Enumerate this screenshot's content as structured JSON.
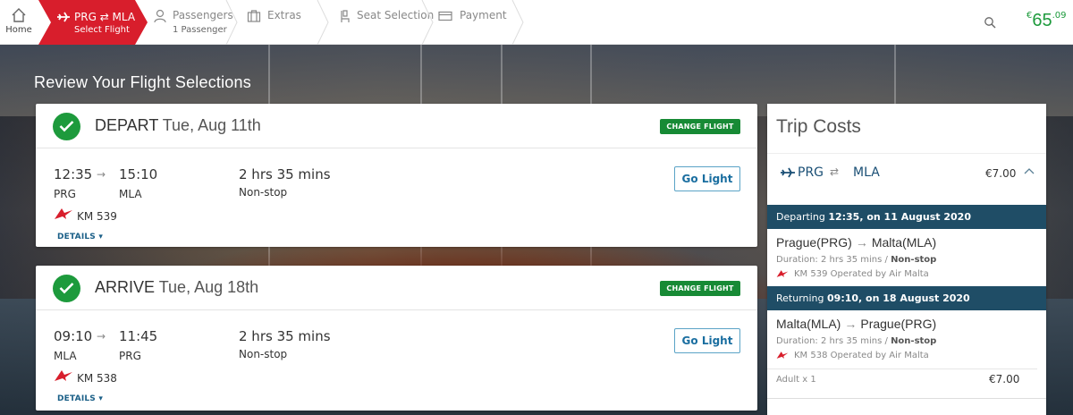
{
  "nav": {
    "home_label": "Home",
    "active": {
      "route": "PRG ⇄ MLA",
      "sub": "Select Flight"
    },
    "steps": [
      {
        "label": "Passengers",
        "sub": "1 Passenger"
      },
      {
        "label": "Extras"
      },
      {
        "label": "Seat Selection"
      },
      {
        "label": "Payment"
      }
    ],
    "total": {
      "currency": "€",
      "main": "65",
      "cents": ".09"
    }
  },
  "review_title": "Review Your Flight Selections",
  "flights": [
    {
      "direction": "DEPART",
      "date": "Tue, Aug 11th",
      "change_label": "CHANGE FLIGHT",
      "dep_time": "12:35",
      "arr_time": "15:10",
      "from": "PRG",
      "to": "MLA",
      "duration": "2 hrs 35 mins",
      "stops": "Non-stop",
      "flight_no": "KM 539",
      "details_label": "DETAILS ▾",
      "fare_button": "Go Light"
    },
    {
      "direction": "ARRIVE",
      "date": "Tue, Aug 18th",
      "change_label": "CHANGE FLIGHT",
      "dep_time": "09:10",
      "arr_time": "11:45",
      "from": "MLA",
      "to": "PRG",
      "duration": "2 hrs 35 mins",
      "stops": "Non-stop",
      "flight_no": "KM 538",
      "details_label": "DETAILS ▾",
      "fare_button": "Go Light"
    }
  ],
  "trip": {
    "title": "Trip Costs",
    "route_from": "PRG",
    "route_to": "MLA",
    "route_price": "€7.00",
    "departing": {
      "prefix": "Departing",
      "time": "12:35",
      "date": ", on 11 August 2020",
      "from": "Prague(PRG)",
      "to": "Malta(MLA)",
      "duration_prefix": "Duration: 2 hrs 35 mins / ",
      "stops": "Non-stop",
      "operated": "KM 539   Operated by Air Malta"
    },
    "returning": {
      "prefix": "Returning",
      "time": "09:10",
      "date": ", on 18 August 2020",
      "from": "Malta(MLA)",
      "to": "Prague(PRG)",
      "duration_prefix": "Duration: 2 hrs 35 mins / ",
      "stops": "Non-stop",
      "operated": "KM 538   Operated by Air Malta"
    },
    "pax_label": "Adult x 1",
    "pax_price": "€7.00"
  },
  "colors": {
    "accent_red": "#d81e2c",
    "green": "#1d9a3c",
    "navy": "#1f4d66",
    "link": "#1a6ea0"
  }
}
